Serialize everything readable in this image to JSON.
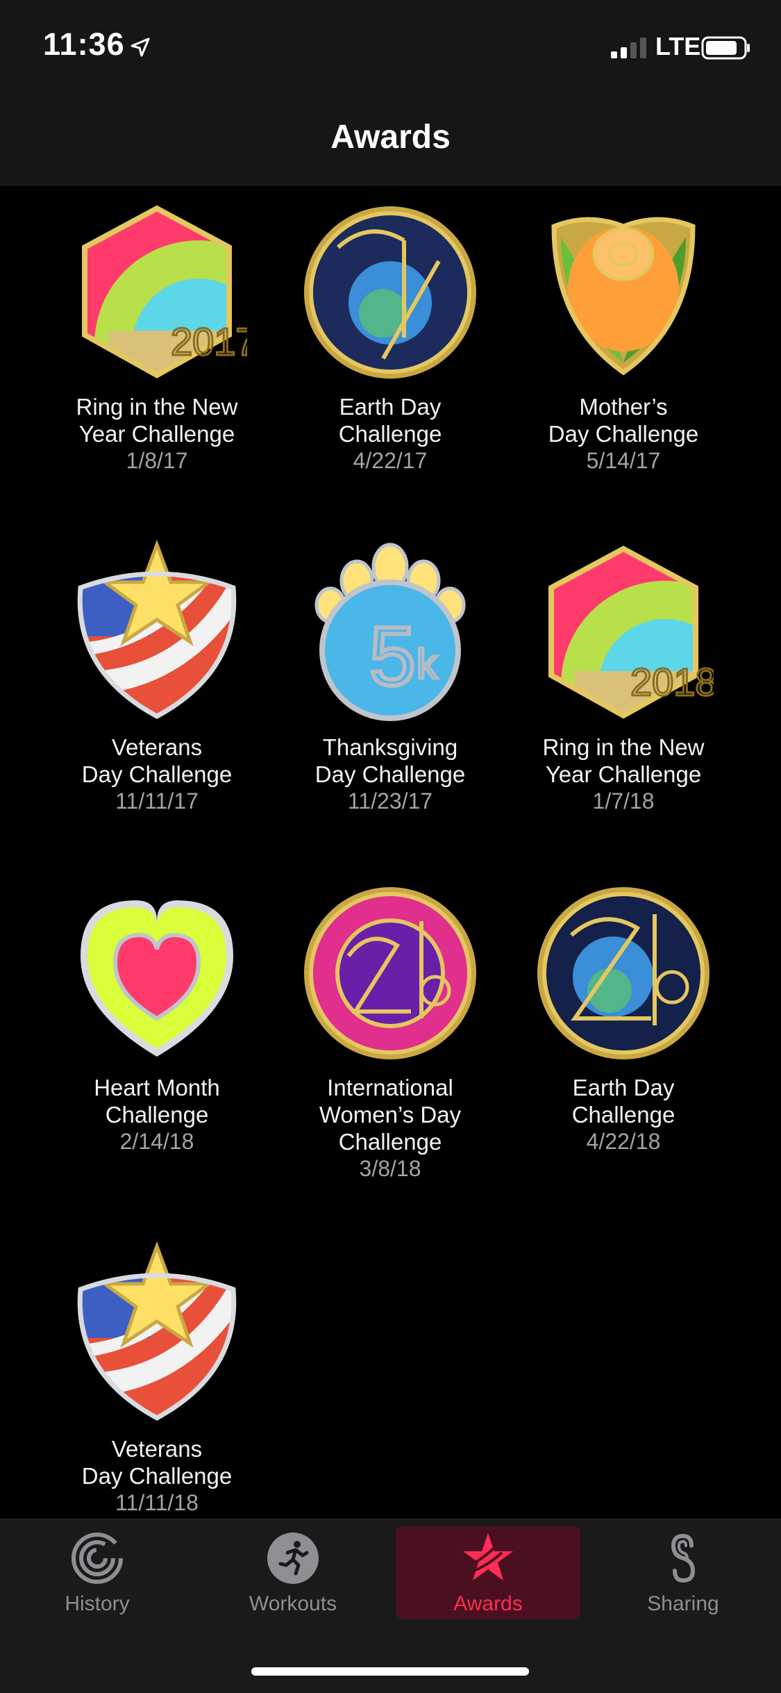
{
  "status": {
    "time": "11:36",
    "network": "LTE"
  },
  "header": {
    "title": "Awards"
  },
  "awards": [
    {
      "name": "Ring in the New Year Challenge",
      "line1": "Ring in the New",
      "line2": "Year Challenge",
      "date": "1/8/17"
    },
    {
      "name": "Earth Day Challenge",
      "line1": "Earth Day",
      "line2": "Challenge",
      "date": "4/22/17"
    },
    {
      "name": "Mother’s Day Challenge",
      "line1": "Mother’s",
      "line2": "Day Challenge",
      "date": "5/14/17"
    },
    {
      "name": "Veterans Day Challenge",
      "line1": "Veterans",
      "line2": "Day Challenge",
      "date": "11/11/17"
    },
    {
      "name": "Thanksgiving Day Challenge",
      "line1": "Thanksgiving",
      "line2": "Day Challenge",
      "date": "11/23/17"
    },
    {
      "name": "Ring in the New Year Challenge",
      "line1": "Ring in the New",
      "line2": "Year Challenge",
      "date": "1/7/18"
    },
    {
      "name": "Heart Month Challenge",
      "line1": "Heart Month",
      "line2": "Challenge",
      "date": "2/14/18"
    },
    {
      "name": "International Women’s Day Challenge",
      "line1": "International",
      "line2": "Women’s Day",
      "line3": "Challenge",
      "date": "3/8/18"
    },
    {
      "name": "Earth Day Challenge",
      "line1": "Earth Day",
      "line2": "Challenge",
      "date": "4/22/18"
    },
    {
      "name": "Veterans Day Challenge",
      "line1": "Veterans",
      "line2": "Day Challenge",
      "date": "11/11/18"
    }
  ],
  "tabs": [
    {
      "label": "History",
      "icon": "history-rings-icon"
    },
    {
      "label": "Workouts",
      "icon": "workout-runner-icon"
    },
    {
      "label": "Awards",
      "icon": "awards-star-icon",
      "active": true
    },
    {
      "label": "Sharing",
      "icon": "sharing-icon"
    }
  ],
  "colors": {
    "accent": "#ff2d55",
    "background": "#000000",
    "bar": "#161616",
    "secondary_text": "#a3a3a8"
  }
}
